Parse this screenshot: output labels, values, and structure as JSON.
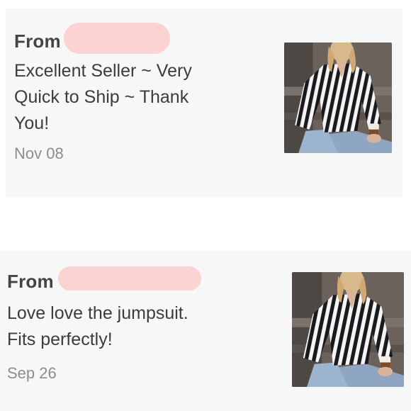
{
  "reviews": [
    {
      "from_label": "From",
      "text": "Excellent Seller ~ Very\nQuick to Ship ~ Thank\nYou!",
      "date": "Nov 08",
      "photo_icon": "product-photo-striped-blouse"
    },
    {
      "from_label": "From",
      "text": "Love love the jumpsuit.\nFits perfectly!",
      "date": "Sep 26",
      "photo_icon": "product-photo-striped-blouse"
    }
  ],
  "colors": {
    "card_background": "#f8f7f8",
    "redaction": "#fbd3d2",
    "text_primary": "#3c3b3e",
    "text_secondary": "#8d8b8f"
  }
}
